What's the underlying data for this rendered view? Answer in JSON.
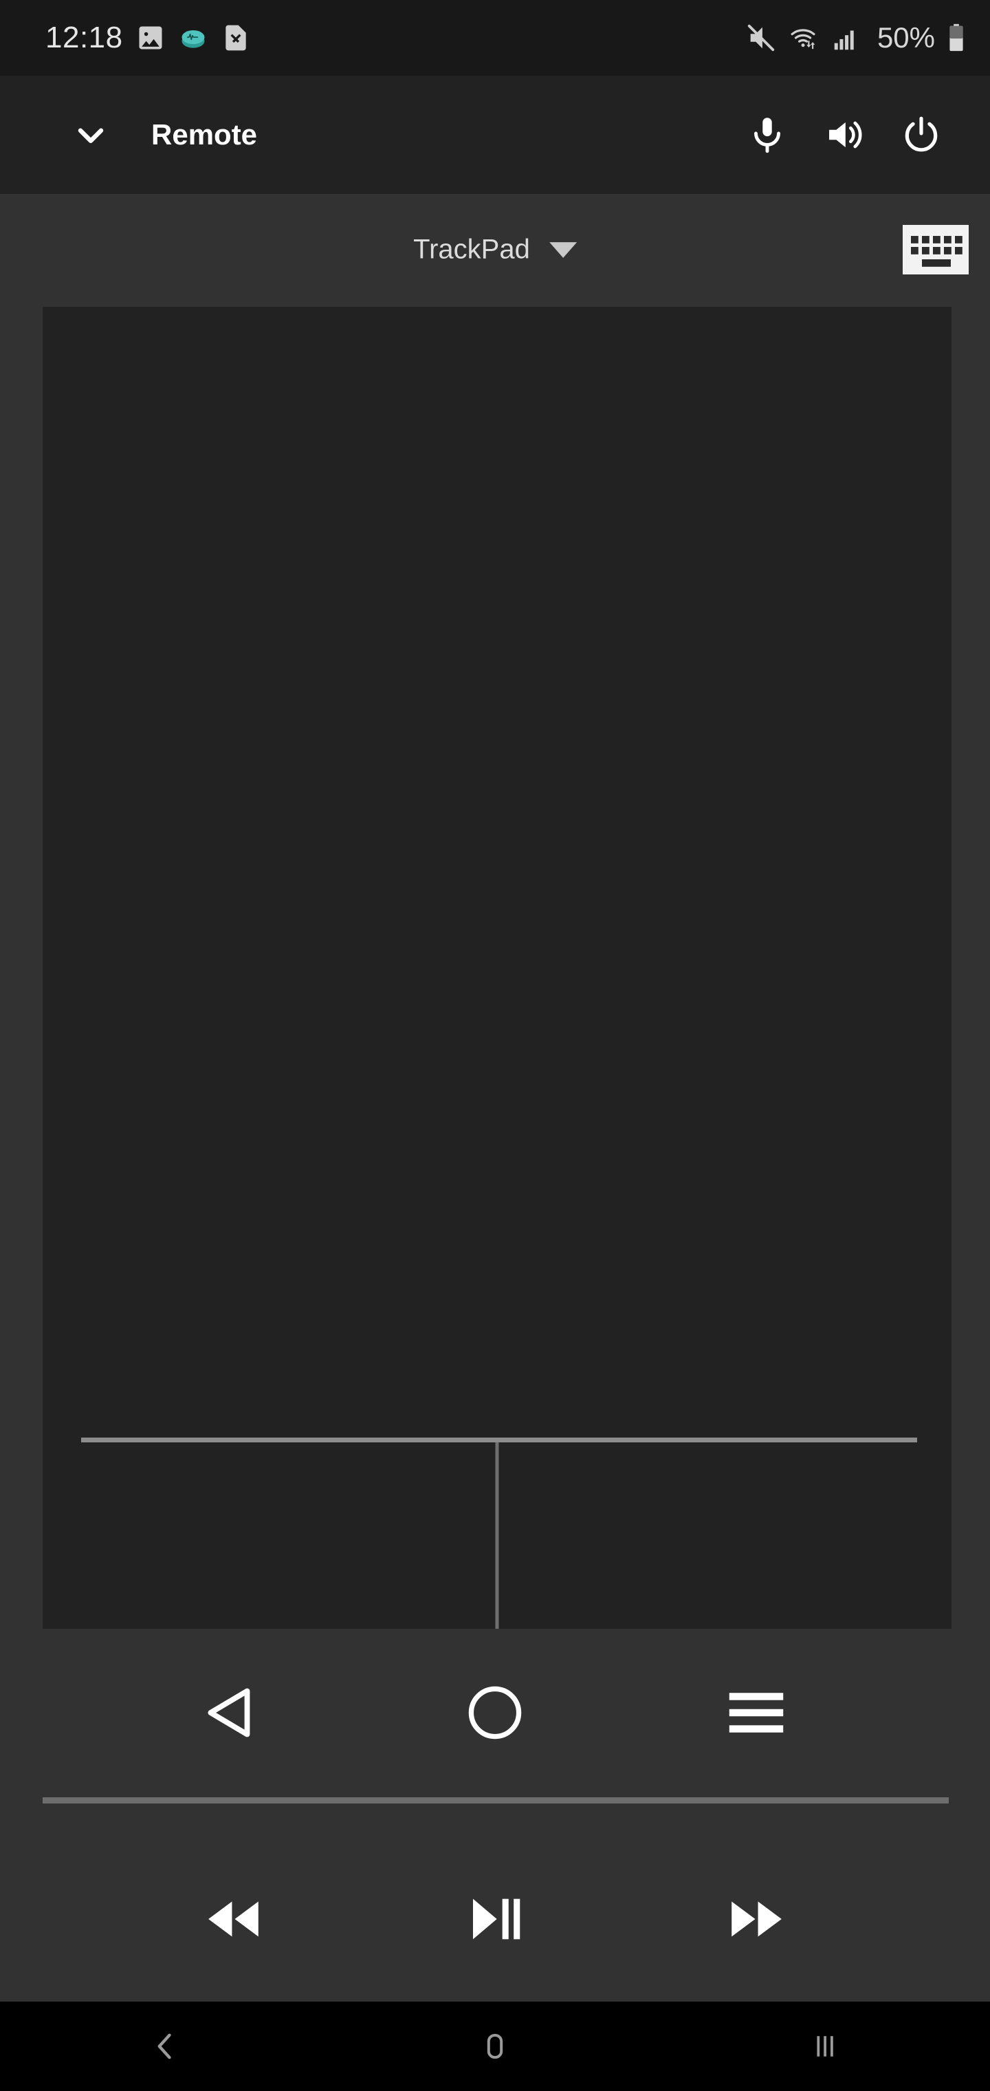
{
  "status_bar": {
    "time": "12:18",
    "battery_percent": "50%",
    "icons": [
      {
        "name": "gallery-icon"
      },
      {
        "name": "audio-recorder-icon",
        "color": "#4fc3bd"
      },
      {
        "name": "file-error-icon"
      }
    ],
    "right_icons": [
      {
        "name": "mute-icon"
      },
      {
        "name": "wifi-icon"
      },
      {
        "name": "signal-bars-icon"
      },
      {
        "name": "battery-icon"
      }
    ],
    "colors": {
      "background": "#181818",
      "text": "#e6e6e6",
      "accent": "#4fc3bd"
    }
  },
  "app_bar": {
    "title": "Remote",
    "collapse_icon": "chevron-down-icon",
    "actions": [
      {
        "name": "microphone-button",
        "icon": "microphone-icon"
      },
      {
        "name": "volume-button",
        "icon": "volume-up-icon"
      },
      {
        "name": "power-button",
        "icon": "power-icon"
      }
    ],
    "colors": {
      "background": "#222222",
      "text": "#ffffff"
    }
  },
  "mode_row": {
    "selected_mode": "TrackPad",
    "dropdown_icon": "caret-down-icon",
    "keyboard_button": {
      "name": "keyboard-button",
      "icon": "keyboard-icon"
    }
  },
  "trackpad": {
    "surface_name": "trackpad-surface",
    "left_click_label": "",
    "right_click_label": "",
    "colors": {
      "surface": "#222222",
      "divider": "#8d8d8d",
      "divider_vertical": "#6f6f6f"
    }
  },
  "nav_controls": [
    {
      "name": "back-button",
      "icon": "back-triangle-icon"
    },
    {
      "name": "home-button",
      "icon": "home-circle-icon"
    },
    {
      "name": "menu-button",
      "icon": "hamburger-menu-icon"
    }
  ],
  "media_controls": [
    {
      "name": "rewind-button",
      "icon": "rewind-icon"
    },
    {
      "name": "play-pause-button",
      "icon": "play-pause-icon"
    },
    {
      "name": "fast-forward-button",
      "icon": "fast-forward-icon"
    }
  ],
  "system_nav": [
    {
      "name": "system-back-button",
      "icon": "chevron-left-icon"
    },
    {
      "name": "system-home-button",
      "icon": "rounded-square-icon"
    },
    {
      "name": "system-recents-button",
      "icon": "three-bars-icon"
    }
  ],
  "colors": {
    "page_background": "#323232",
    "panel": "#222222",
    "system_nav_background": "#000000",
    "icon_white": "#ffffff",
    "icon_gray": "#9a9a9a"
  }
}
